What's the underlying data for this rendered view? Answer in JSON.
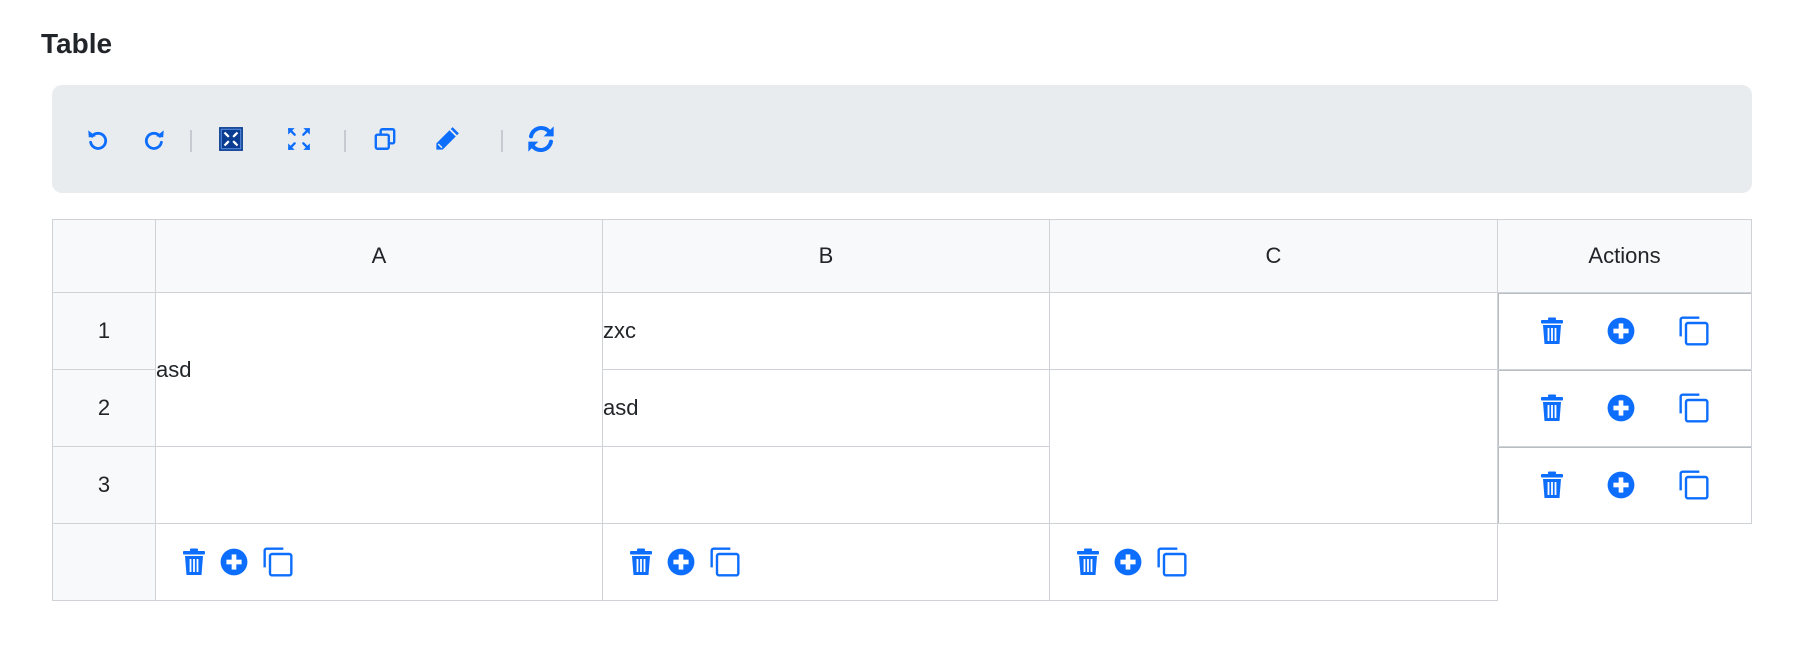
{
  "page": {
    "title": "Table"
  },
  "toolbar": {
    "buttons": [
      {
        "name": "undo-icon"
      },
      {
        "name": "redo-icon"
      },
      {
        "name": "merge-cells-icon"
      },
      {
        "name": "split-cells-icon"
      },
      {
        "name": "copy-icon"
      },
      {
        "name": "edit-icon"
      },
      {
        "name": "refresh-icon"
      }
    ]
  },
  "table": {
    "headers": [
      "",
      "A",
      "B",
      "C",
      "Actions"
    ],
    "rows": [
      {
        "num": "1",
        "a": "asd",
        "b": "zxc",
        "c": ""
      },
      {
        "num": "2",
        "a": "",
        "b": "asd",
        "c": ""
      },
      {
        "num": "3",
        "a": "",
        "b": "",
        "c": ""
      }
    ],
    "merged": {
      "a_rows_1_2": "asd",
      "c_rows_2_3": ""
    }
  },
  "icons": {
    "delete": "trash-icon",
    "add": "plus-circle-icon",
    "duplicate": "duplicate-icon"
  },
  "colors": {
    "accent": "#0d6efd",
    "accent_dark": "#0a3d91",
    "toolbar_bg": "#e9ecef",
    "header_bg": "#f8f9fa",
    "border": "#cfd3d7"
  }
}
